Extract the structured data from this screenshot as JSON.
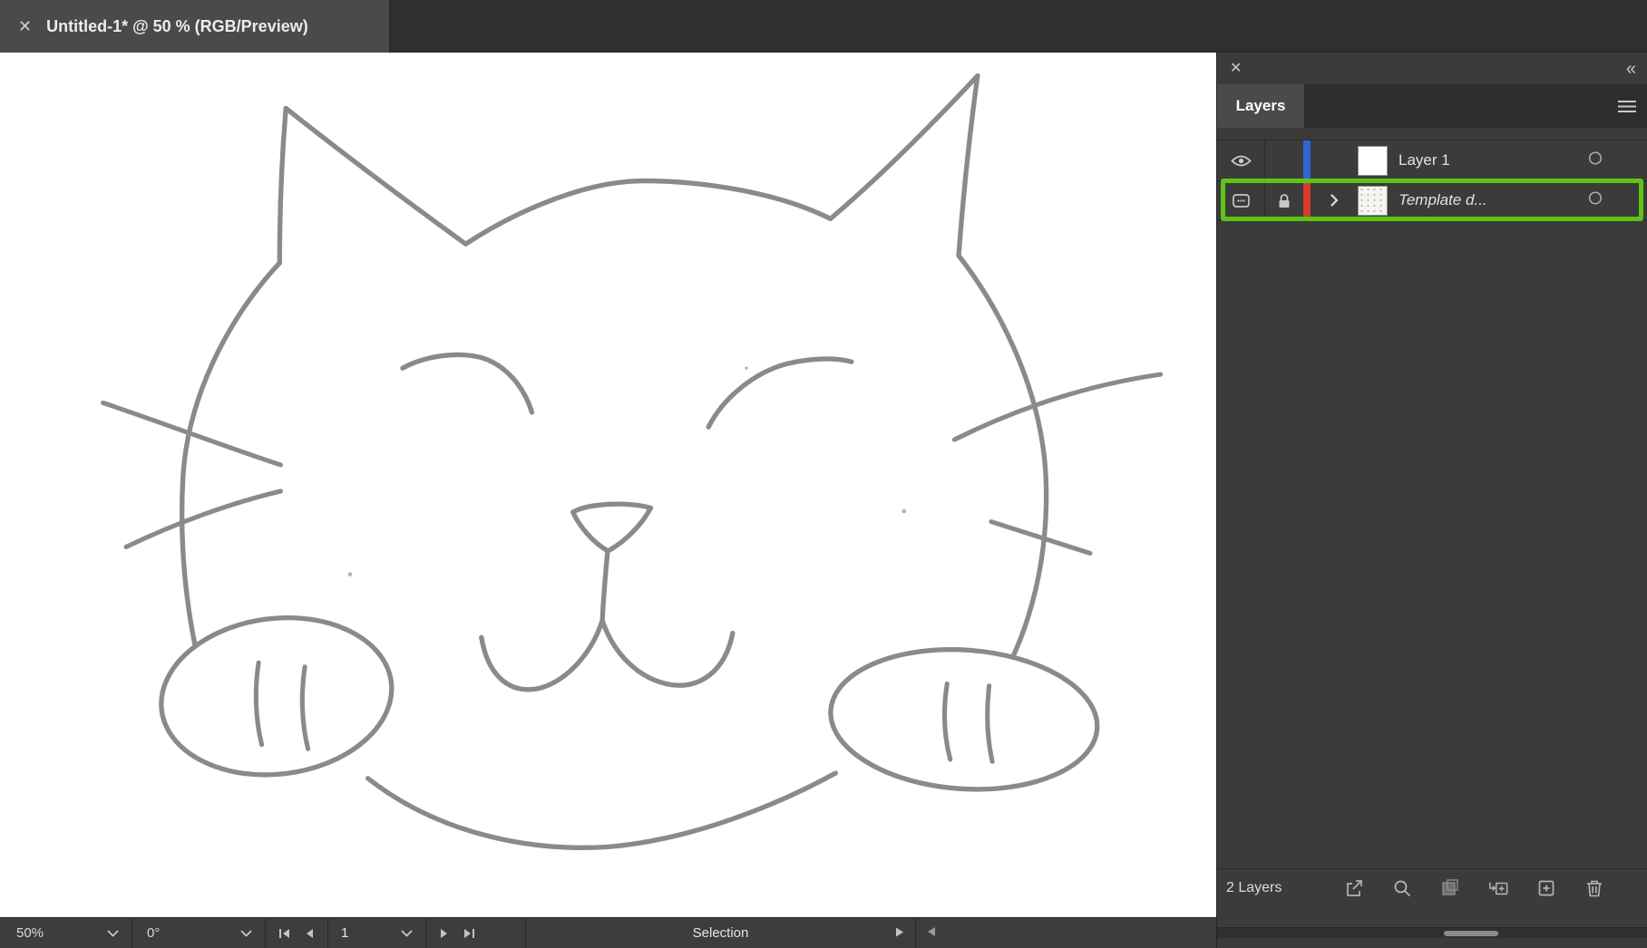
{
  "tab_bar": {
    "title": "Untitled-1* @ 50 % (RGB/Preview)"
  },
  "icons": {
    "tab_close": "✕",
    "panel_close": "✕",
    "collapse_left": "«"
  },
  "layers_panel": {
    "tab_label": "Layers",
    "rows": [
      {
        "name": "Layer 1",
        "color": "#2e67d3",
        "selected": false,
        "visible": true,
        "locked": false
      },
      {
        "name": "Template d...",
        "color": "#d93a2b",
        "selected": true,
        "visible": false,
        "locked": true
      }
    ],
    "footer_count": "2 Layers"
  },
  "status_bar": {
    "zoom": "50%",
    "rotation": "0°",
    "artboard_number": "1",
    "tool_status": "Selection"
  },
  "annotation": {
    "highlight_color": "#5bc514"
  }
}
